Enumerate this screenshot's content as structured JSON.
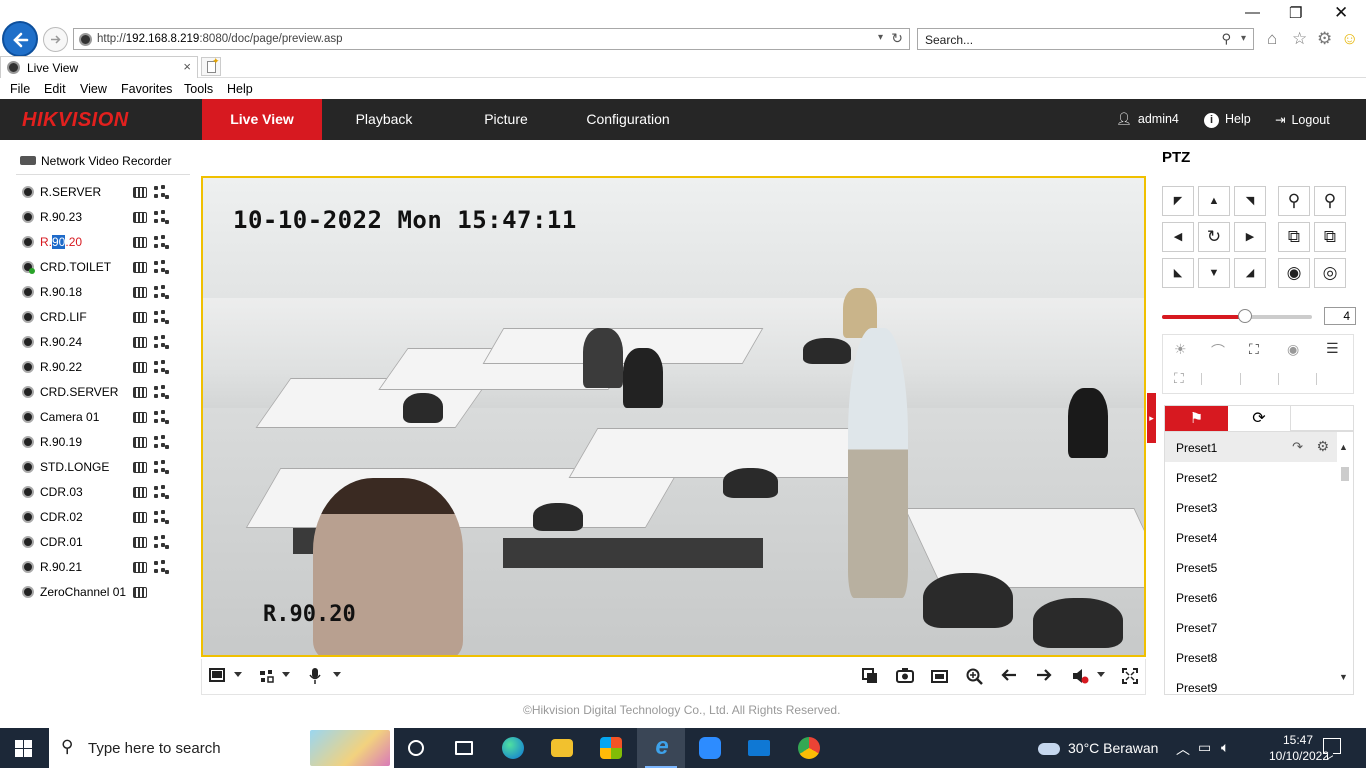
{
  "browser": {
    "url_prefix": "http://",
    "url_host": "192.168.8.219",
    "url_rest": ":8080/doc/page/preview.asp",
    "search_placeholder": "Search...",
    "tab_title": "Live View",
    "menu": [
      "File",
      "Edit",
      "View",
      "Favorites",
      "Tools",
      "Help"
    ]
  },
  "app": {
    "brand": "HIKVISION",
    "nav": [
      "Live View",
      "Playback",
      "Picture",
      "Configuration"
    ],
    "active_nav": "Live View",
    "user": "admin4",
    "help": "Help",
    "logout": "Logout",
    "accent": "#d71920",
    "header_bg": "#262626"
  },
  "tree": {
    "root": "Network Video Recorder",
    "cameras": [
      {
        "name": "R.SERVER"
      },
      {
        "name": "R.90.23"
      },
      {
        "name_pre": "R.",
        "name_sel": "90",
        "name_post": ".20",
        "active": true
      },
      {
        "name": "CRD.TOILET",
        "status": "recording"
      },
      {
        "name": "R.90.18"
      },
      {
        "name": "CRD.LIF"
      },
      {
        "name": "R.90.24"
      },
      {
        "name": "R.90.22"
      },
      {
        "name": "CRD.SERVER"
      },
      {
        "name": "Camera 01"
      },
      {
        "name": "R.90.19"
      },
      {
        "name": "STD.LONGE"
      },
      {
        "name": "CDR.03"
      },
      {
        "name": "CDR.02"
      },
      {
        "name": "CDR.01"
      },
      {
        "name": "R.90.21"
      },
      {
        "name": "ZeroChannel 01"
      }
    ]
  },
  "video": {
    "osd_datetime": "10-10-2022 Mon 15:47:11",
    "osd_channel": "R.90.20"
  },
  "footer": "©Hikvision Digital Technology Co., Ltd. All Rights Reserved.",
  "ptz": {
    "title": "PTZ",
    "speed": "4",
    "speed_fraction": 0.55,
    "presets": [
      "Preset1",
      "Preset2",
      "Preset3",
      "Preset4",
      "Preset5",
      "Preset6",
      "Preset7",
      "Preset8",
      "Preset9"
    ]
  },
  "taskbar": {
    "search_placeholder": "Type here to search",
    "weather": "30°C  Berawan",
    "time": "15:47",
    "date": "10/10/2022"
  }
}
